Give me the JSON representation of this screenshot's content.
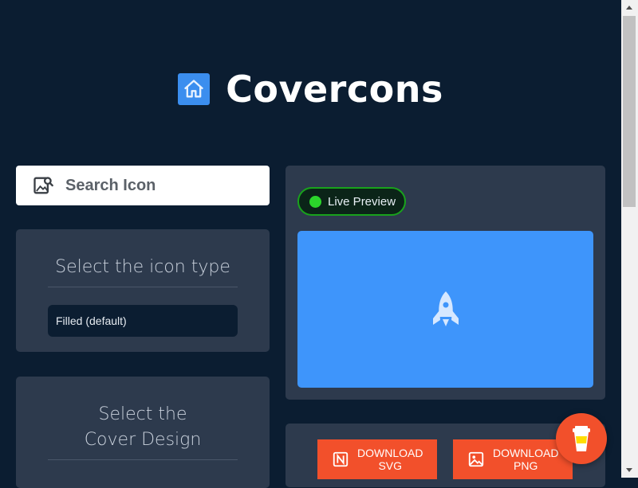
{
  "brand": {
    "title": "Covercons",
    "logo_icon": "home-icon"
  },
  "search": {
    "placeholder": "Search Icon",
    "icon": "image-search-icon"
  },
  "icon_type": {
    "title": "Select the icon type",
    "selected": "Filled (default)"
  },
  "cover_design": {
    "title": "Select the Cover Design"
  },
  "preview": {
    "badge_label": "Live Preview",
    "icon": "rocket-icon",
    "background_color": "#3e95fb"
  },
  "downloads": {
    "svg": {
      "line1": "DOWNLOAD",
      "line2": "SVG",
      "icon": "notion-icon"
    },
    "png": {
      "line1": "DOWNLOAD",
      "line2": "PNG",
      "icon": "image-icon"
    }
  },
  "floating": {
    "icon": "coffee-cup-icon"
  },
  "colors": {
    "accent": "#f2502b",
    "background": "#0b1d31",
    "card": "#2d3a4d",
    "live": "#2bd52b"
  }
}
